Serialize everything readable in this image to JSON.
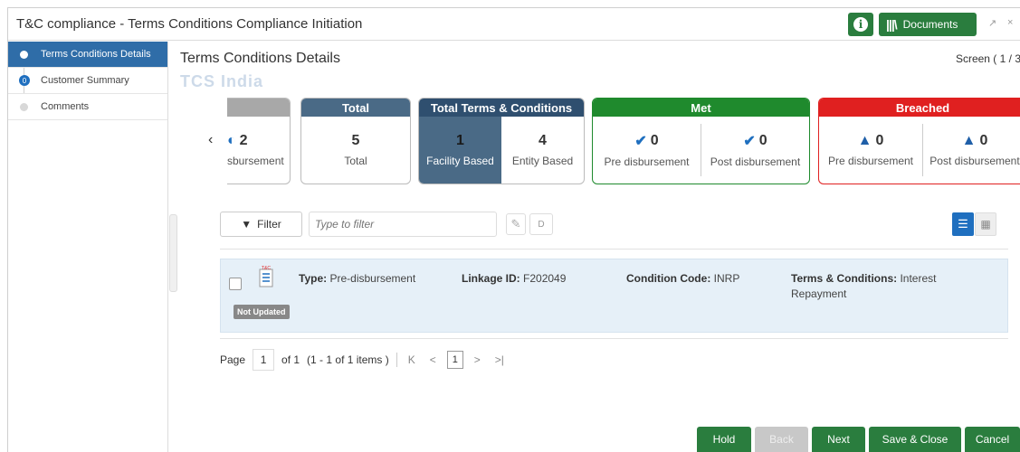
{
  "window": {
    "title": "T&C compliance - Terms Conditions Compliance Initiation",
    "documents_label": "Documents",
    "info_glyph": "i",
    "books_glyph": "|||\\",
    "controls": [
      "↗",
      "×"
    ]
  },
  "sidebar": {
    "items": [
      {
        "label": "Terms Conditions Details",
        "state": "active"
      },
      {
        "label": "Customer Summary",
        "state": "current"
      },
      {
        "label": "Comments",
        "state": "pending"
      }
    ],
    "badge": "0"
  },
  "main": {
    "title": "Terms Conditions Details",
    "screen_indicator": "Screen ( 1 / 3",
    "entity_name": "TCS India"
  },
  "cards": {
    "partial": {
      "value": "2",
      "label": "sbursement"
    },
    "total": {
      "title": "Total",
      "value": "5",
      "label": "Total"
    },
    "tc": {
      "title": "Total Terms & Conditions",
      "facility_value": "1",
      "facility_label": "Facility Based",
      "entity_value": "4",
      "entity_label": "Entity Based"
    },
    "met": {
      "title": "Met",
      "pre_value": "0",
      "pre_label": "Pre disbursement",
      "post_value": "0",
      "post_label": "Post disbursement"
    },
    "breached": {
      "title": "Breached",
      "pre_value": "0",
      "pre_label": "Pre disbursement",
      "post_value": "0",
      "post_label": "Post disbursement"
    },
    "colors": {
      "total": "#4a6a86",
      "tc": "#2f4f6f",
      "met": "#1f8a2d",
      "breached": "#e02020",
      "partial": "#a8a8a8"
    }
  },
  "toolbar": {
    "filter_label": "Filter",
    "filter_placeholder": "Type to filter",
    "d_label": "D"
  },
  "record": {
    "badge": "Not Updated",
    "icon_text": "T&C",
    "type_label": "Type:",
    "type_value": "Pre-disbursement",
    "linkage_label": "Linkage ID:",
    "linkage_value": "F202049",
    "condition_label": "Condition Code:",
    "condition_value": "INRP",
    "terms_label": "Terms & Conditions:",
    "terms_value_line1": "Interest",
    "terms_value_line2": "Repayment"
  },
  "pager": {
    "page_label": "Page",
    "page_value": "1",
    "of_text": "of 1",
    "range_text": "(1 - 1 of 1 items )",
    "current": "1",
    "first": "K",
    "prev": "<",
    "next": ">",
    "last": ">|"
  },
  "footer": {
    "hold": "Hold",
    "back": "Back",
    "next": "Next",
    "save_close": "Save & Close",
    "cancel": "Cancel"
  }
}
